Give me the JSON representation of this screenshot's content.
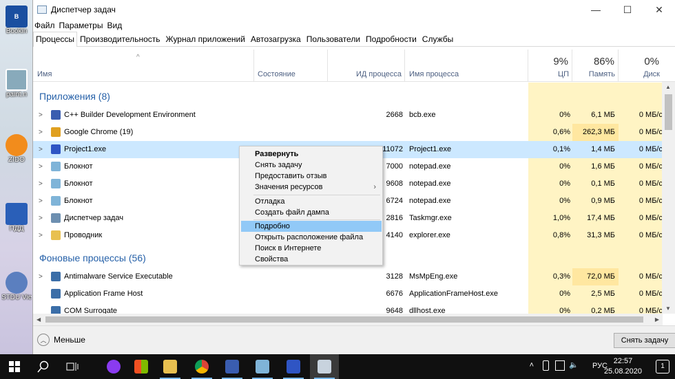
{
  "desktop": {
    "icons": [
      {
        "label": "Bookin",
        "color": "#1a4fa0"
      },
      {
        "label": "paint.n",
        "color": "#8ab"
      },
      {
        "label": "ZIDO",
        "color": "#f28c1c"
      },
      {
        "label": "ПДД",
        "color": "#2a5fb8"
      },
      {
        "label": "STDU Vie",
        "color": "#5b7fbf"
      }
    ]
  },
  "window": {
    "title": "Диспетчер задач",
    "menu": [
      "Файл",
      "Параметры",
      "Вид"
    ],
    "tabs": [
      "Процессы",
      "Производительность",
      "Журнал приложений",
      "Автозагрузка",
      "Пользователи",
      "Подробности",
      "Службы"
    ],
    "active_tab": "Процессы"
  },
  "table": {
    "headers": {
      "name": "Имя",
      "status": "Состояние",
      "pid": "ИД процесса",
      "image": "Имя процесса",
      "cpu": "ЦП",
      "memory": "Память",
      "disk": "Диск"
    },
    "totals": {
      "cpu": "9%",
      "memory": "86%",
      "disk": "0%"
    },
    "groups": {
      "apps": "Приложения (8)",
      "background": "Фоновые процессы (56)"
    },
    "apps": [
      {
        "name": "C++ Builder Development Environment",
        "pid": "2668",
        "image": "bcb.exe",
        "cpu": "0%",
        "mem": "6,1 МБ",
        "disk": "0 МБ/с",
        "icon": "cpp-builder-icon",
        "color": "#3a5db0"
      },
      {
        "name": "Google Chrome (19)",
        "pid": "",
        "image": "",
        "cpu": "0,6%",
        "mem": "262,3 МБ",
        "disk": "0 МБ/с",
        "icon": "chrome-icon",
        "color": "#e0a020"
      },
      {
        "name": "Project1.exe",
        "pid": "11072",
        "image": "Project1.exe",
        "cpu": "0,1%",
        "mem": "1,4 МБ",
        "disk": "0 МБ/с",
        "icon": "project-icon",
        "color": "#2f55c4"
      },
      {
        "name": "Блокнот",
        "pid": "7000",
        "image": "notepad.exe",
        "cpu": "0%",
        "mem": "1,6 МБ",
        "disk": "0 МБ/с",
        "icon": "notepad-icon",
        "color": "#7fb4d8"
      },
      {
        "name": "Блокнот",
        "pid": "9608",
        "image": "notepad.exe",
        "cpu": "0%",
        "mem": "0,1 МБ",
        "disk": "0 МБ/с",
        "icon": "notepad-icon",
        "color": "#7fb4d8"
      },
      {
        "name": "Блокнот",
        "pid": "6724",
        "image": "notepad.exe",
        "cpu": "0%",
        "mem": "0,9 МБ",
        "disk": "0 МБ/с",
        "icon": "notepad-icon",
        "color": "#7fb4d8"
      },
      {
        "name": "Диспетчер задач",
        "pid": "2816",
        "image": "Taskmgr.exe",
        "cpu": "1,0%",
        "mem": "17,4 МБ",
        "disk": "0 МБ/с",
        "icon": "taskmgr-icon",
        "color": "#6d8fb0"
      },
      {
        "name": "Проводник",
        "pid": "4140",
        "image": "explorer.exe",
        "cpu": "0,8%",
        "mem": "31,3 МБ",
        "disk": "0 МБ/с",
        "icon": "folder-icon",
        "color": "#e8c050"
      }
    ],
    "background": [
      {
        "name": "Antimalware Service Executable",
        "pid": "3128",
        "image": "MsMpEng.exe",
        "cpu": "0,3%",
        "mem": "72,0 МБ",
        "disk": "0 МБ/с",
        "icon": "service-icon",
        "color": "#3b6ea8"
      },
      {
        "name": "Application Frame Host",
        "pid": "6676",
        "image": "ApplicationFrameHost.exe",
        "cpu": "0%",
        "mem": "2,5 МБ",
        "disk": "0 МБ/с",
        "icon": "service-icon",
        "color": "#3b6ea8"
      },
      {
        "name": "COM Surrogate",
        "pid": "9648",
        "image": "dllhost.exe",
        "cpu": "0%",
        "mem": "0,2 МБ",
        "disk": "0 МБ/с",
        "icon": "service-icon",
        "color": "#3b6ea8"
      }
    ]
  },
  "context_menu": {
    "items": [
      "Развернуть",
      "Снять задачу",
      "Предоставить отзыв",
      "Значения ресурсов",
      "Отладка",
      "Создать файл дампа",
      "Подробно",
      "Открыть расположение файла",
      "Поиск в Интернете",
      "Свойства"
    ]
  },
  "footer": {
    "less_label": "Меньше",
    "end_task_label": "Снять задачу"
  },
  "taskbar": {
    "language": "РУС",
    "time": "22:57",
    "date": "25.08.2020",
    "notification_count": "1"
  },
  "colors": {
    "accent_group": "#2560a8",
    "heat_light": "#fff4c4",
    "heat_medium": "#ffe7a0",
    "selection": "#cce8ff",
    "menu_highlight": "#91c9f7"
  }
}
